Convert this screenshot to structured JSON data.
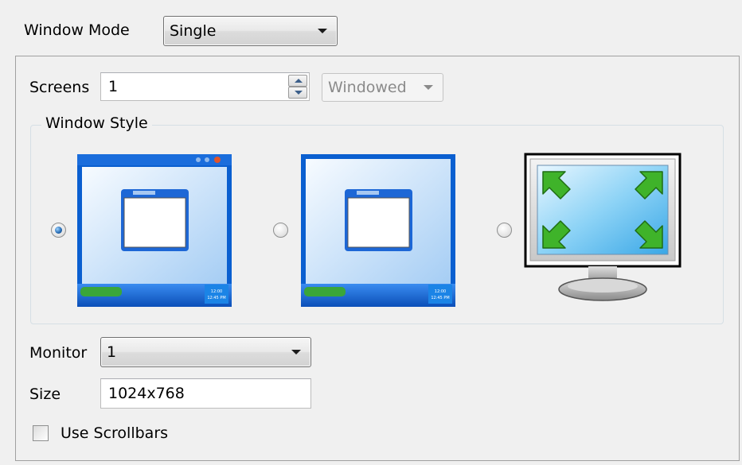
{
  "window_mode": {
    "label": "Window Mode",
    "value": "Single"
  },
  "screens": {
    "label": "Screens",
    "value": "1",
    "mode_value": "Windowed"
  },
  "window_style": {
    "title": "Window Style",
    "options": [
      {
        "name": "window-with-title-bar",
        "checked": true
      },
      {
        "name": "window-without-title-bar",
        "checked": false
      },
      {
        "name": "fullscreen",
        "checked": false
      }
    ],
    "taskbar_clock": "12:00\n12:45 PM"
  },
  "monitor": {
    "label": "Monitor",
    "value": "1"
  },
  "size": {
    "label": "Size",
    "value": "1024x768"
  },
  "scrollbars": {
    "label": "Use Scrollbars",
    "checked": false
  },
  "colors": {
    "xp_blue": "#0a5fd0",
    "desktop_top": "#f4f9ff",
    "desktop_bottom": "#a7cff5",
    "arrow_green": "#3fb32a"
  }
}
